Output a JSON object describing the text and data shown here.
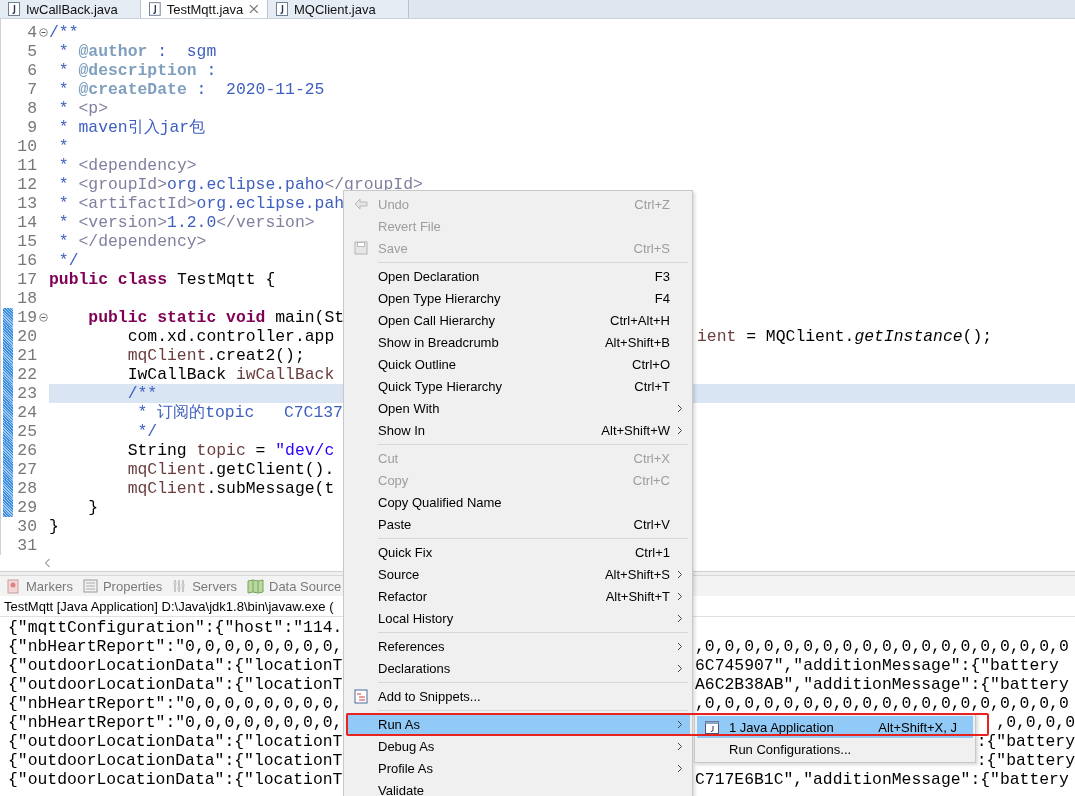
{
  "editor_tabs": [
    {
      "label": "IwCallBack.java",
      "selected": false,
      "closable": false
    },
    {
      "label": "TestMqtt.java",
      "selected": true,
      "closable": true
    },
    {
      "label": "MQClient.java",
      "selected": false,
      "closable": false
    }
  ],
  "editor": {
    "lines": [
      {
        "number": "4",
        "fold": true,
        "changed": false,
        "current": false,
        "left": [
          {
            "kind": "doc",
            "text": "/**"
          }
        ]
      },
      {
        "number": "5",
        "fold": false,
        "changed": false,
        "current": false,
        "left": [
          {
            "kind": "doc",
            "text": " * "
          },
          {
            "kind": "doctag",
            "text": "@author"
          },
          {
            "kind": "doc",
            "text": " :  sgm"
          }
        ]
      },
      {
        "number": "6",
        "fold": false,
        "changed": false,
        "current": false,
        "left": [
          {
            "kind": "doc",
            "text": " * "
          },
          {
            "kind": "doctag",
            "text": "@description"
          },
          {
            "kind": "doc",
            "text": " :"
          }
        ]
      },
      {
        "number": "7",
        "fold": false,
        "changed": false,
        "current": false,
        "left": [
          {
            "kind": "doc",
            "text": " * "
          },
          {
            "kind": "doctag",
            "text": "@createDate"
          },
          {
            "kind": "doc",
            "text": " :  2020-11-25"
          }
        ]
      },
      {
        "number": "8",
        "fold": false,
        "changed": false,
        "current": false,
        "left": [
          {
            "kind": "doc",
            "text": " * "
          },
          {
            "kind": "dochtml",
            "text": "<p>"
          }
        ]
      },
      {
        "number": "9",
        "fold": false,
        "changed": false,
        "current": false,
        "left": [
          {
            "kind": "doc",
            "text": " * maven引入jar包"
          }
        ]
      },
      {
        "number": "10",
        "fold": false,
        "changed": false,
        "current": false,
        "left": [
          {
            "kind": "doc",
            "text": " *"
          }
        ]
      },
      {
        "number": "11",
        "fold": false,
        "changed": false,
        "current": false,
        "left": [
          {
            "kind": "doc",
            "text": " * "
          },
          {
            "kind": "dochtml",
            "text": "<dependency>"
          }
        ]
      },
      {
        "number": "12",
        "fold": false,
        "changed": false,
        "current": false,
        "left": [
          {
            "kind": "doc",
            "text": " * "
          },
          {
            "kind": "dochtml",
            "text": "<groupId>"
          },
          {
            "kind": "doc",
            "text": "org.eclipse.paho"
          },
          {
            "kind": "dochtml",
            "text": "</groupId>"
          }
        ]
      },
      {
        "number": "13",
        "fold": false,
        "changed": false,
        "current": false,
        "left": [
          {
            "kind": "doc",
            "text": " * "
          },
          {
            "kind": "dochtml",
            "text": "<artifactId>"
          },
          {
            "kind": "doc",
            "text": "org.eclipse.pah"
          }
        ]
      },
      {
        "number": "14",
        "fold": false,
        "changed": false,
        "current": false,
        "left": [
          {
            "kind": "doc",
            "text": " * "
          },
          {
            "kind": "dochtml",
            "text": "<version>"
          },
          {
            "kind": "doc",
            "text": "1.2.0"
          },
          {
            "kind": "dochtml",
            "text": "</version>"
          }
        ]
      },
      {
        "number": "15",
        "fold": false,
        "changed": false,
        "current": false,
        "left": [
          {
            "kind": "doc",
            "text": " * "
          },
          {
            "kind": "dochtml",
            "text": "</dependency>"
          }
        ]
      },
      {
        "number": "16",
        "fold": false,
        "changed": false,
        "current": false,
        "left": [
          {
            "kind": "doc",
            "text": " */"
          }
        ]
      },
      {
        "number": "17",
        "fold": false,
        "changed": false,
        "current": false,
        "left": [
          {
            "kind": "keyword",
            "text": "public class"
          },
          {
            "kind": "plain",
            "text": " TestMqtt {"
          }
        ]
      },
      {
        "number": "18",
        "fold": false,
        "changed": false,
        "current": false
      },
      {
        "number": "19",
        "fold": true,
        "changed": true,
        "current": false,
        "left": [
          {
            "kind": "keyword",
            "text": "    public static void"
          },
          {
            "kind": "plain",
            "text": " main(St"
          }
        ]
      },
      {
        "number": "20",
        "fold": false,
        "changed": true,
        "current": false,
        "left": [
          {
            "kind": "plain",
            "text": "        com.xd.controller.app"
          }
        ],
        "right": [
          {
            "kind": "local",
            "text": "ient"
          },
          {
            "kind": "plain",
            "text": " = MQClient."
          },
          {
            "kind": "italic",
            "text": "getInstance"
          },
          {
            "kind": "plain",
            "text": "();"
          }
        ]
      },
      {
        "number": "21",
        "fold": false,
        "changed": true,
        "current": false,
        "left": [
          {
            "kind": "local",
            "text": "        mqClient"
          },
          {
            "kind": "plain",
            "text": ".creat2();"
          }
        ]
      },
      {
        "number": "22",
        "fold": false,
        "changed": true,
        "current": false,
        "left": [
          {
            "kind": "plain",
            "text": "        IwCallBack "
          },
          {
            "kind": "local",
            "text": "iwCallBack"
          }
        ]
      },
      {
        "number": "23",
        "fold": false,
        "changed": true,
        "current": true,
        "left": [
          {
            "kind": "comment",
            "text": "        /**"
          }
        ]
      },
      {
        "number": "24",
        "fold": false,
        "changed": true,
        "current": false,
        "left": [
          {
            "kind": "comment",
            "text": "         * 订阅的topic   C7C137"
          }
        ]
      },
      {
        "number": "25",
        "fold": false,
        "changed": true,
        "current": false,
        "left": [
          {
            "kind": "comment",
            "text": "         */"
          }
        ]
      },
      {
        "number": "26",
        "fold": false,
        "changed": true,
        "current": false,
        "left": [
          {
            "kind": "plain",
            "text": "        String "
          },
          {
            "kind": "local",
            "text": "topic"
          },
          {
            "kind": "plain",
            "text": " = "
          },
          {
            "kind": "string",
            "text": "\"dev/c"
          }
        ]
      },
      {
        "number": "27",
        "fold": false,
        "changed": true,
        "current": false,
        "left": [
          {
            "kind": "local",
            "text": "        mqClient"
          },
          {
            "kind": "plain",
            "text": ".getClient()."
          }
        ]
      },
      {
        "number": "28",
        "fold": false,
        "changed": true,
        "current": false,
        "left": [
          {
            "kind": "local",
            "text": "        mqClient"
          },
          {
            "kind": "plain",
            "text": ".subMessage(t"
          }
        ]
      },
      {
        "number": "29",
        "fold": false,
        "changed": true,
        "current": false,
        "left": [
          {
            "kind": "plain",
            "text": "    }"
          }
        ]
      },
      {
        "number": "30",
        "fold": false,
        "changed": false,
        "current": false,
        "left": [
          {
            "kind": "plain",
            "text": "}"
          }
        ]
      },
      {
        "number": "31",
        "fold": false,
        "changed": false,
        "current": false
      }
    ]
  },
  "panel_tabs": [
    {
      "label": "Markers"
    },
    {
      "label": "Properties"
    },
    {
      "label": "Servers"
    },
    {
      "label": "Data Source"
    }
  ],
  "console": {
    "header": "TestMqtt [Java Application] D:\\Java\\jdk1.8\\bin\\javaw.exe (",
    "rows": [
      {
        "segments": [
          {
            "kind": "lead",
            "text": "{\"mqttConfiguration\":{\"host\":\"114."
          }
        ]
      },
      {
        "segments": [
          {
            "kind": "lead",
            "text": "{\"nbHeartReport\":\"0,0,0,0,0,0,0,0,"
          },
          {
            "kind": "after-menu",
            "text": ",0,0,0,0,0,0,0,0,0,0,0,0,0,0,0,0,0,0,0"
          }
        ]
      },
      {
        "segments": [
          {
            "kind": "lead",
            "text": "{\"outdoorLocationData\":{\"locationT"
          },
          {
            "kind": "after-menu",
            "text": "6C745907\",\"additionMessage\":{\"battery"
          }
        ]
      },
      {
        "segments": [
          {
            "kind": "lead",
            "text": "{\"outdoorLocationData\":{\"locationT"
          },
          {
            "kind": "after-menu",
            "text": "A6C2B38AB\",\"additionMessage\":{\"battery"
          }
        ]
      },
      {
        "segments": [
          {
            "kind": "lead",
            "text": "{\"nbHeartReport\":\"0,0,0,0,0,0,0,0,"
          },
          {
            "kind": "after-menu",
            "text": ",0,0,0,0,0,0,0,0,0,0,0,0,0,0,0,0,0,0,0"
          }
        ]
      },
      {
        "segments": [
          {
            "kind": "lead",
            "text": "{\"nbHeartReport\":\"0,0,0,0,0,0,0,0,"
          },
          {
            "kind": "after-submenu",
            "text": ",0,0,0,0"
          }
        ]
      },
      {
        "segments": [
          {
            "kind": "lead",
            "text": "{\"outdoorLocationData\":{\"locationT"
          },
          {
            "kind": "after-submenu",
            "text": ":{\"battery"
          }
        ]
      },
      {
        "segments": [
          {
            "kind": "lead",
            "text": "{\"outdoorLocationData\":{\"locationT"
          },
          {
            "kind": "after-submenu",
            "text": ":{\"battery"
          }
        ]
      },
      {
        "segments": [
          {
            "kind": "lead",
            "text": "{\"outdoorLocationData\":{\"locationT"
          },
          {
            "kind": "after-menu",
            "text": "C717E6B1C\",\"additionMessage\":{\"battery"
          }
        ]
      }
    ]
  },
  "context_menu": {
    "items": [
      {
        "kind": "item",
        "label": "Undo",
        "shortcut": "Ctrl+Z",
        "disabled": true,
        "selected": false,
        "submenu": false
      },
      {
        "kind": "item",
        "label": "Revert File",
        "disabled": true,
        "selected": false,
        "submenu": false
      },
      {
        "kind": "item",
        "label": "Save",
        "shortcut": "Ctrl+S",
        "disabled": true,
        "selected": false,
        "submenu": false
      },
      {
        "kind": "separator"
      },
      {
        "kind": "item",
        "label": "Open Declaration",
        "shortcut": "F3",
        "disabled": false,
        "selected": false,
        "submenu": false
      },
      {
        "kind": "item",
        "label": "Open Type Hierarchy",
        "shortcut": "F4",
        "disabled": false,
        "selected": false,
        "submenu": false
      },
      {
        "kind": "item",
        "label": "Open Call Hierarchy",
        "shortcut": "Ctrl+Alt+H",
        "disabled": false,
        "selected": false,
        "submenu": false
      },
      {
        "kind": "item",
        "label": "Show in Breadcrumb",
        "shortcut": "Alt+Shift+B",
        "disabled": false,
        "selected": false,
        "submenu": false
      },
      {
        "kind": "item",
        "label": "Quick Outline",
        "shortcut": "Ctrl+O",
        "disabled": false,
        "selected": false,
        "submenu": false
      },
      {
        "kind": "item",
        "label": "Quick Type Hierarchy",
        "shortcut": "Ctrl+T",
        "disabled": false,
        "selected": false,
        "submenu": false
      },
      {
        "kind": "item",
        "label": "Open With",
        "disabled": false,
        "selected": false,
        "submenu": true
      },
      {
        "kind": "item",
        "label": "Show In",
        "shortcut": "Alt+Shift+W",
        "disabled": false,
        "selected": false,
        "submenu": true
      },
      {
        "kind": "separator"
      },
      {
        "kind": "item",
        "label": "Cut",
        "shortcut": "Ctrl+X",
        "disabled": true,
        "selected": false,
        "submenu": false
      },
      {
        "kind": "item",
        "label": "Copy",
        "shortcut": "Ctrl+C",
        "disabled": true,
        "selected": false,
        "submenu": false
      },
      {
        "kind": "item",
        "label": "Copy Qualified Name",
        "disabled": false,
        "selected": false,
        "submenu": false
      },
      {
        "kind": "item",
        "label": "Paste",
        "shortcut": "Ctrl+V",
        "disabled": false,
        "selected": false,
        "submenu": false
      },
      {
        "kind": "separator"
      },
      {
        "kind": "item",
        "label": "Quick Fix",
        "shortcut": "Ctrl+1",
        "disabled": false,
        "selected": false,
        "submenu": false
      },
      {
        "kind": "item",
        "label": "Source",
        "shortcut": "Alt+Shift+S",
        "disabled": false,
        "selected": false,
        "submenu": true
      },
      {
        "kind": "item",
        "label": "Refactor",
        "shortcut": "Alt+Shift+T",
        "disabled": false,
        "selected": false,
        "submenu": true
      },
      {
        "kind": "item",
        "label": "Local History",
        "disabled": false,
        "selected": false,
        "submenu": true
      },
      {
        "kind": "separator"
      },
      {
        "kind": "item",
        "label": "References",
        "disabled": false,
        "selected": false,
        "submenu": true
      },
      {
        "kind": "item",
        "label": "Declarations",
        "disabled": false,
        "selected": false,
        "submenu": true
      },
      {
        "kind": "separator"
      },
      {
        "kind": "item",
        "label": "Add to Snippets...",
        "disabled": false,
        "selected": false,
        "submenu": false
      },
      {
        "kind": "separator"
      },
      {
        "kind": "item",
        "label": "Run As",
        "disabled": false,
        "selected": true,
        "submenu": true
      },
      {
        "kind": "item",
        "label": "Debug As",
        "disabled": false,
        "selected": false,
        "submenu": true
      },
      {
        "kind": "item",
        "label": "Profile As",
        "disabled": false,
        "selected": false,
        "submenu": true
      },
      {
        "kind": "item",
        "label": "Validate",
        "disabled": false,
        "selected": false,
        "submenu": false
      }
    ]
  },
  "annotation_frame": true,
  "submenu": {
    "items": [
      {
        "label": "1 Java Application",
        "shortcut": "Alt+Shift+X, J",
        "selected": true
      },
      {
        "label": "Run Configurations...",
        "selected": false
      }
    ]
  }
}
